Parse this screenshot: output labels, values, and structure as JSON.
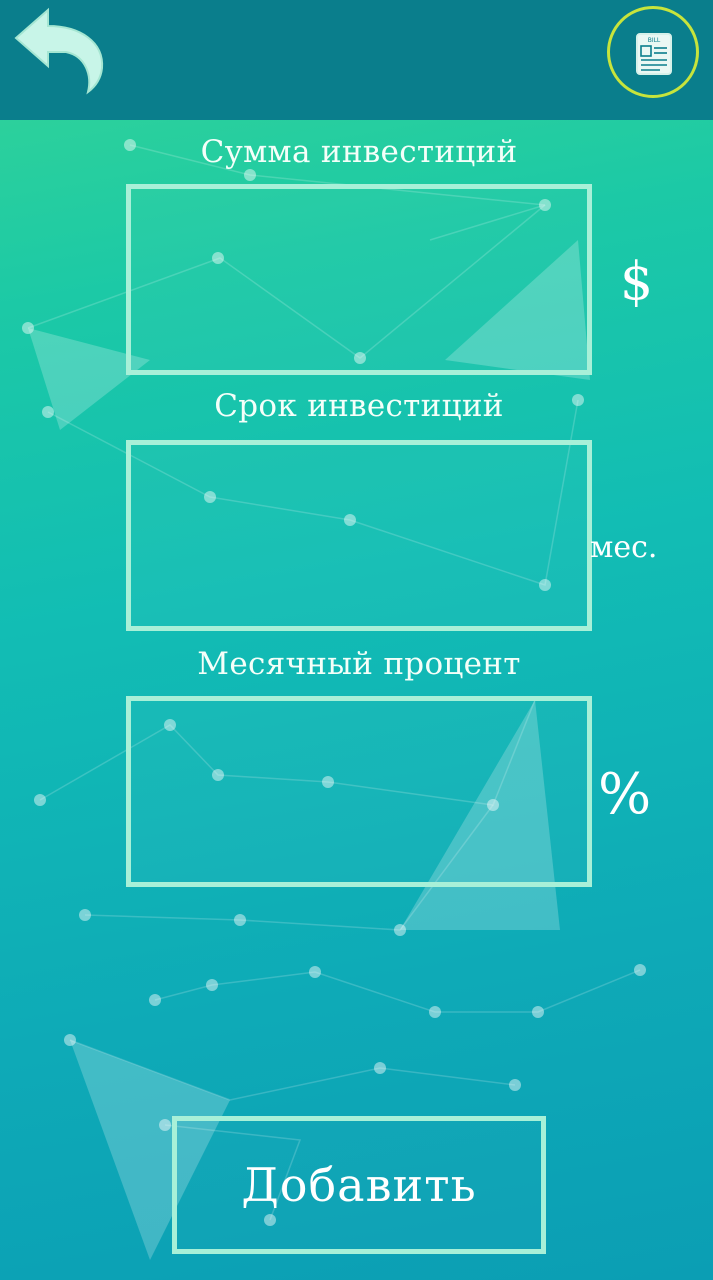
{
  "header": {
    "back_icon": "back-arrow-icon",
    "bill_icon": "bill-document-icon",
    "bill_icon_text": "BILL",
    "colors": {
      "bar": "#0a7e8c",
      "ring": "#c7e43c",
      "icon": "#c8f5e8"
    }
  },
  "form": {
    "investment_amount": {
      "label": "Сумма инвестиций",
      "value": "",
      "unit": "$"
    },
    "investment_term": {
      "label": "Срок инвестиций",
      "value": "",
      "unit": "мес."
    },
    "monthly_percent": {
      "label": "Месячный процент",
      "value": "",
      "unit": "%"
    }
  },
  "actions": {
    "add_label": "Добавить"
  },
  "colors": {
    "field_border": "#a8f0d8",
    "text": "#ffffff"
  }
}
